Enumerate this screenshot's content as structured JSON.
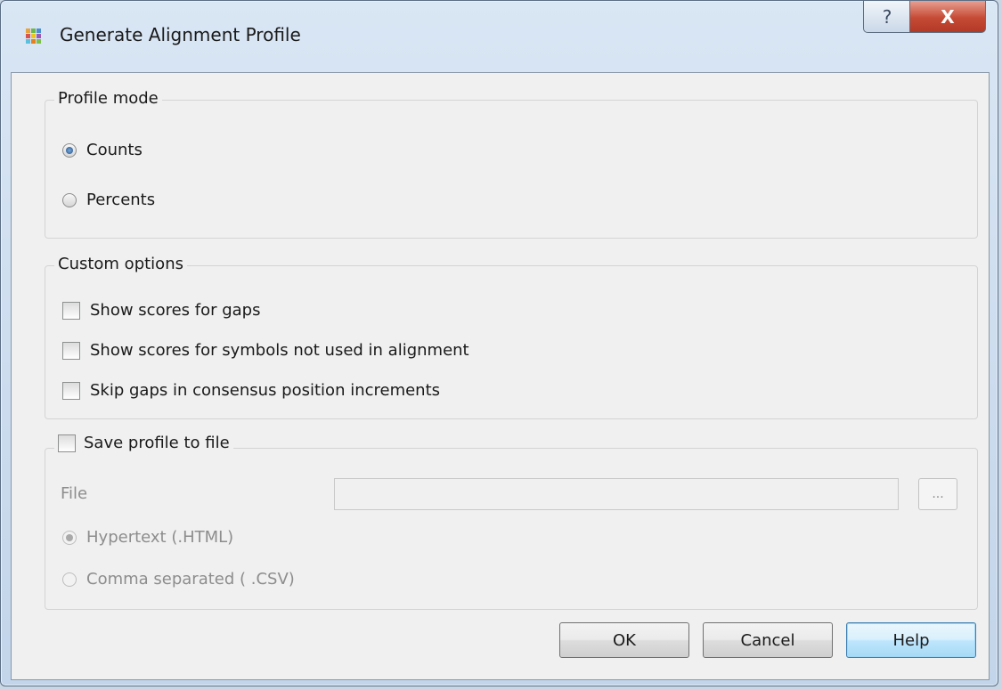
{
  "window": {
    "title": "Generate Alignment Profile",
    "help_symbol": "?",
    "close_symbol": "X"
  },
  "profile_mode": {
    "legend": "Profile mode",
    "options": [
      {
        "label": "Counts",
        "selected": true
      },
      {
        "label": "Percents",
        "selected": false
      }
    ]
  },
  "custom_options": {
    "legend": "Custom options",
    "items": [
      {
        "label": "Show scores for gaps",
        "checked": false
      },
      {
        "label": "Show scores for symbols not used in alignment",
        "checked": false
      },
      {
        "label": "Skip gaps in consensus position increments",
        "checked": false
      }
    ]
  },
  "save_profile": {
    "label": "Save profile to file",
    "checked": false,
    "file_label": "File",
    "file_value": "",
    "browse_label": "...",
    "formats": [
      {
        "label": "Hypertext  (.HTML)",
        "selected": true
      },
      {
        "label": "Comma separated ( .CSV)",
        "selected": false
      }
    ]
  },
  "buttons": {
    "ok": "OK",
    "cancel": "Cancel",
    "help": "Help"
  }
}
